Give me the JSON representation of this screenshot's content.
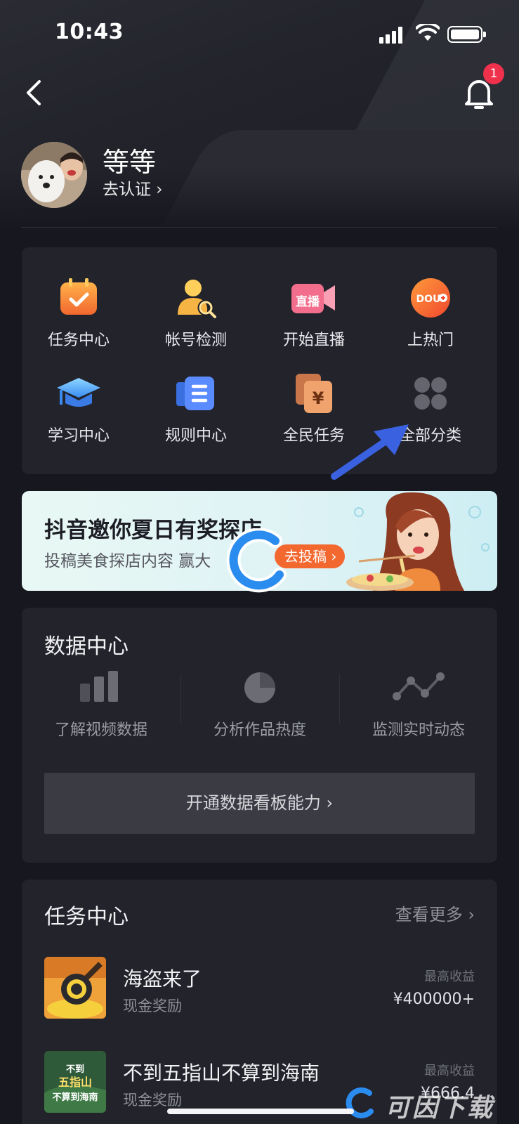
{
  "status_bar": {
    "time": "10:43"
  },
  "header": {
    "notification_count": "1"
  },
  "profile": {
    "name": "等等",
    "verify_label": "去认证 ›"
  },
  "tools": [
    {
      "label": "任务中心",
      "icon": "calendar-check-icon"
    },
    {
      "label": "帐号检测",
      "icon": "user-search-icon"
    },
    {
      "label": "开始直播",
      "icon": "live-camera-icon"
    },
    {
      "label": "上热门",
      "icon": "dou-plus-icon"
    },
    {
      "label": "学习中心",
      "icon": "graduation-cap-icon"
    },
    {
      "label": "规则中心",
      "icon": "rules-book-icon"
    },
    {
      "label": "全民任务",
      "icon": "yuan-cards-icon"
    },
    {
      "label": "全部分类",
      "icon": "grid-dots-icon"
    }
  ],
  "banner": {
    "title": "抖音邀你夏日有奖探店",
    "subtitle": "投稿美食探店内容 赢大",
    "button_label": "去投稿 ›"
  },
  "data_center": {
    "title": "数据中心",
    "items": [
      {
        "label": "了解视频数据",
        "icon": "bar-chart-icon"
      },
      {
        "label": "分析作品热度",
        "icon": "pie-chart-icon"
      },
      {
        "label": "监测实时动态",
        "icon": "line-trend-icon"
      }
    ],
    "button_label": "开通数据看板能力  ›"
  },
  "task_center": {
    "title": "任务中心",
    "more_label": "查看更多  ›",
    "tasks": [
      {
        "name": "海盗来了",
        "reward": "现金奖励",
        "max_label": "最高收益",
        "amount": "¥400000+"
      },
      {
        "name": "不到五指山不算到海南",
        "reward": "现金奖励",
        "max_label": "最高收益",
        "amount": "¥666.4"
      }
    ]
  },
  "watermark": {
    "text": "可因下载"
  },
  "colors": {
    "background": "#17171f",
    "card": "#22232b",
    "accent_orange": "#f2682f",
    "badge_red": "#f0314c"
  }
}
